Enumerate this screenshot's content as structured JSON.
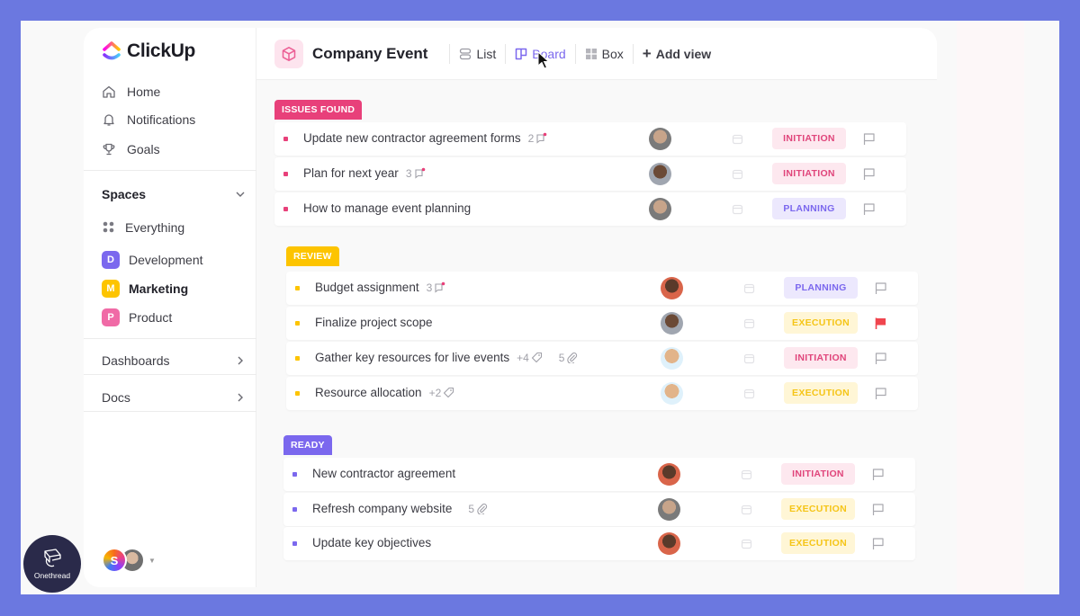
{
  "app": {
    "name": "ClickUp"
  },
  "sidebar": {
    "nav": [
      {
        "label": "Home",
        "icon": "home-icon"
      },
      {
        "label": "Notifications",
        "icon": "bell-icon"
      },
      {
        "label": "Goals",
        "icon": "trophy-icon"
      }
    ],
    "spaces_label": "Spaces",
    "spaces": [
      {
        "label": "Everything",
        "badge": "",
        "color": ""
      },
      {
        "label": "Development",
        "badge": "D",
        "color": "#7b68ee"
      },
      {
        "label": "Marketing",
        "badge": "M",
        "color": "#fdc400"
      },
      {
        "label": "Product",
        "badge": "P",
        "color": "#f06aa6"
      }
    ],
    "dashboards_label": "Dashboards",
    "docs_label": "Docs",
    "user_initial": "S"
  },
  "header": {
    "project_title": "Company Event",
    "views": [
      {
        "label": "List",
        "icon": "list-icon"
      },
      {
        "label": "Board",
        "icon": "board-icon",
        "active": true
      },
      {
        "label": "Box",
        "icon": "box-icon"
      }
    ],
    "add_view_label": "Add view"
  },
  "colors": {
    "issues": "#e8407a",
    "review": "#fdc400",
    "ready": "#7b68ee",
    "initiation_bg": "#fde8ef",
    "initiation_fg": "#e0457b",
    "planning_bg": "#ece8fd",
    "planning_fg": "#7b68ee",
    "execution_bg": "#fff6d6",
    "execution_fg": "#f5c518",
    "flag_red": "#f0454e"
  },
  "groups": [
    {
      "label": "ISSUES FOUND",
      "tasks": [
        {
          "name": "Update new contractor agreement forms",
          "comments": "2",
          "stage": "INITIATION",
          "flagged": false
        },
        {
          "name": "Plan for next year",
          "comments": "3",
          "stage": "INITIATION",
          "flagged": false
        },
        {
          "name": "How to manage event planning",
          "stage": "PLANNING",
          "flagged": false
        }
      ]
    },
    {
      "label": "REVIEW",
      "tasks": [
        {
          "name": "Budget assignment",
          "comments": "3",
          "stage": "PLANNING",
          "flagged": false
        },
        {
          "name": "Finalize project scope",
          "stage": "EXECUTION",
          "flagged": true
        },
        {
          "name": "Gather key resources for live events",
          "tags": "+4",
          "attachments": "5",
          "stage": "INITIATION",
          "flagged": false
        },
        {
          "name": "Resource allocation",
          "tags": "+2",
          "stage": "EXECUTION",
          "flagged": false
        }
      ]
    },
    {
      "label": "READY",
      "tasks": [
        {
          "name": "New contractor agreement",
          "stage": "INITIATION",
          "flagged": false
        },
        {
          "name": "Refresh company website",
          "attachments": "5",
          "stage": "EXECUTION",
          "flagged": false
        },
        {
          "name": "Update key objectives",
          "stage": "EXECUTION",
          "flagged": false
        }
      ]
    }
  ],
  "watermark": {
    "label": "Onethread"
  }
}
